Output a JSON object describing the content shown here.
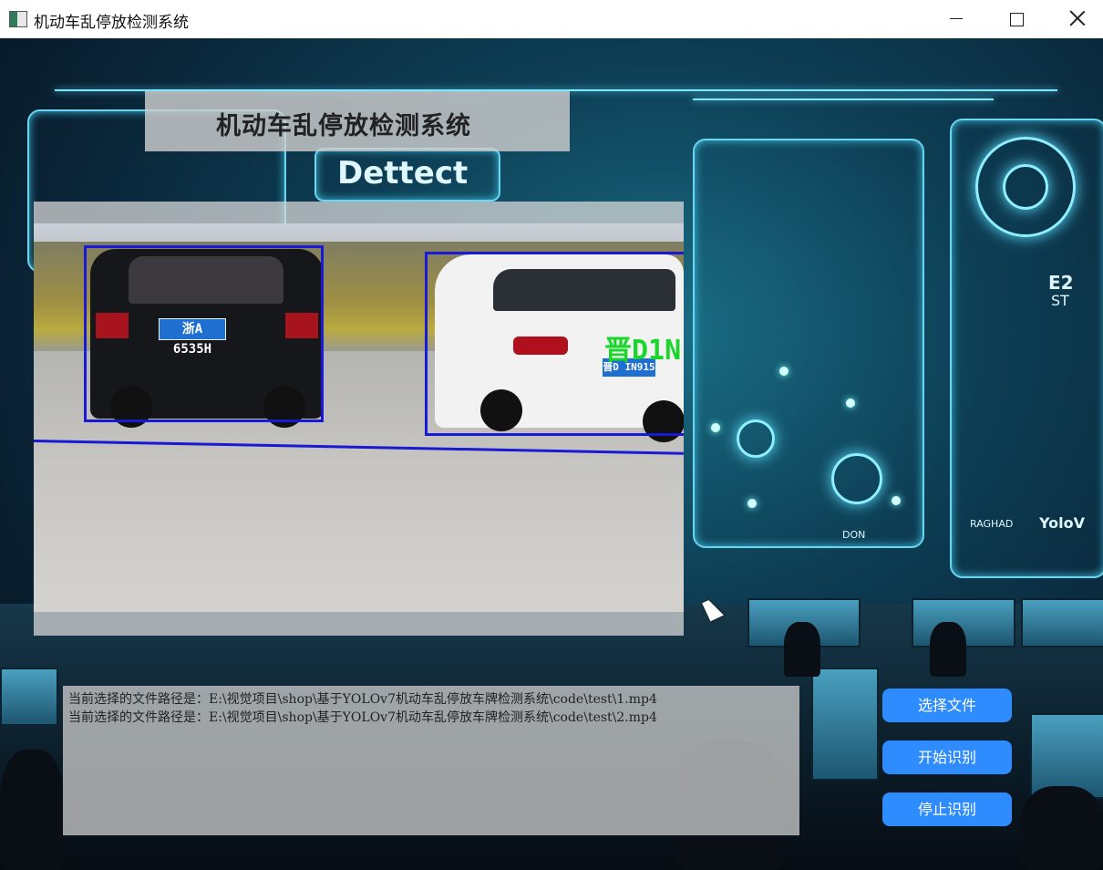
{
  "window": {
    "title": "机动车乱停放检测系统"
  },
  "header": {
    "banner_title": "机动车乱停放检测系统"
  },
  "background": {
    "deco_texts": [
      "Dettect",
      "E2",
      "ST",
      "RAGHAD",
      "YoloV",
      "DON"
    ]
  },
  "video": {
    "plates": [
      "浙A 6535H",
      "晋D IN915"
    ],
    "ocr_label": "晋D1N"
  },
  "log": {
    "lines": [
      "当前选择的文件路径是：E:\\视觉项目\\shop\\基于YOLOv7机动车乱停放车牌检测系统\\code\\test\\1.mp4",
      "当前选择的文件路径是：E:\\视觉项目\\shop\\基于YOLOv7机动车乱停放车牌检测系统\\code\\test\\2.mp4"
    ]
  },
  "controls": {
    "select_file": "选择文件",
    "start": "开始识别",
    "stop": "停止识别"
  },
  "colors": {
    "accent_button": "#2f8cff",
    "bbox": "#1a1ad6",
    "ocr_text": "#1bd62a"
  }
}
